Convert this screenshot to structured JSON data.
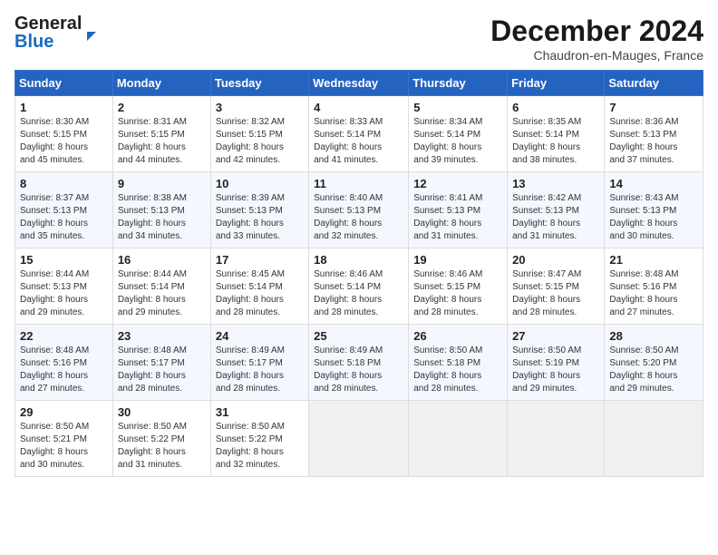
{
  "header": {
    "logo_general": "General",
    "logo_blue": "Blue",
    "title": "December 2024",
    "subtitle": "Chaudron-en-Mauges, France"
  },
  "calendar": {
    "days_of_week": [
      "Sunday",
      "Monday",
      "Tuesday",
      "Wednesday",
      "Thursday",
      "Friday",
      "Saturday"
    ],
    "weeks": [
      [
        {
          "day": "1",
          "info": "Sunrise: 8:30 AM\nSunset: 5:15 PM\nDaylight: 8 hours\nand 45 minutes."
        },
        {
          "day": "2",
          "info": "Sunrise: 8:31 AM\nSunset: 5:15 PM\nDaylight: 8 hours\nand 44 minutes."
        },
        {
          "day": "3",
          "info": "Sunrise: 8:32 AM\nSunset: 5:15 PM\nDaylight: 8 hours\nand 42 minutes."
        },
        {
          "day": "4",
          "info": "Sunrise: 8:33 AM\nSunset: 5:14 PM\nDaylight: 8 hours\nand 41 minutes."
        },
        {
          "day": "5",
          "info": "Sunrise: 8:34 AM\nSunset: 5:14 PM\nDaylight: 8 hours\nand 39 minutes."
        },
        {
          "day": "6",
          "info": "Sunrise: 8:35 AM\nSunset: 5:14 PM\nDaylight: 8 hours\nand 38 minutes."
        },
        {
          "day": "7",
          "info": "Sunrise: 8:36 AM\nSunset: 5:13 PM\nDaylight: 8 hours\nand 37 minutes."
        }
      ],
      [
        {
          "day": "8",
          "info": "Sunrise: 8:37 AM\nSunset: 5:13 PM\nDaylight: 8 hours\nand 35 minutes."
        },
        {
          "day": "9",
          "info": "Sunrise: 8:38 AM\nSunset: 5:13 PM\nDaylight: 8 hours\nand 34 minutes."
        },
        {
          "day": "10",
          "info": "Sunrise: 8:39 AM\nSunset: 5:13 PM\nDaylight: 8 hours\nand 33 minutes."
        },
        {
          "day": "11",
          "info": "Sunrise: 8:40 AM\nSunset: 5:13 PM\nDaylight: 8 hours\nand 32 minutes."
        },
        {
          "day": "12",
          "info": "Sunrise: 8:41 AM\nSunset: 5:13 PM\nDaylight: 8 hours\nand 31 minutes."
        },
        {
          "day": "13",
          "info": "Sunrise: 8:42 AM\nSunset: 5:13 PM\nDaylight: 8 hours\nand 31 minutes."
        },
        {
          "day": "14",
          "info": "Sunrise: 8:43 AM\nSunset: 5:13 PM\nDaylight: 8 hours\nand 30 minutes."
        }
      ],
      [
        {
          "day": "15",
          "info": "Sunrise: 8:44 AM\nSunset: 5:13 PM\nDaylight: 8 hours\nand 29 minutes."
        },
        {
          "day": "16",
          "info": "Sunrise: 8:44 AM\nSunset: 5:14 PM\nDaylight: 8 hours\nand 29 minutes."
        },
        {
          "day": "17",
          "info": "Sunrise: 8:45 AM\nSunset: 5:14 PM\nDaylight: 8 hours\nand 28 minutes."
        },
        {
          "day": "18",
          "info": "Sunrise: 8:46 AM\nSunset: 5:14 PM\nDaylight: 8 hours\nand 28 minutes."
        },
        {
          "day": "19",
          "info": "Sunrise: 8:46 AM\nSunset: 5:15 PM\nDaylight: 8 hours\nand 28 minutes."
        },
        {
          "day": "20",
          "info": "Sunrise: 8:47 AM\nSunset: 5:15 PM\nDaylight: 8 hours\nand 28 minutes."
        },
        {
          "day": "21",
          "info": "Sunrise: 8:48 AM\nSunset: 5:16 PM\nDaylight: 8 hours\nand 27 minutes."
        }
      ],
      [
        {
          "day": "22",
          "info": "Sunrise: 8:48 AM\nSunset: 5:16 PM\nDaylight: 8 hours\nand 27 minutes."
        },
        {
          "day": "23",
          "info": "Sunrise: 8:48 AM\nSunset: 5:17 PM\nDaylight: 8 hours\nand 28 minutes."
        },
        {
          "day": "24",
          "info": "Sunrise: 8:49 AM\nSunset: 5:17 PM\nDaylight: 8 hours\nand 28 minutes."
        },
        {
          "day": "25",
          "info": "Sunrise: 8:49 AM\nSunset: 5:18 PM\nDaylight: 8 hours\nand 28 minutes."
        },
        {
          "day": "26",
          "info": "Sunrise: 8:50 AM\nSunset: 5:18 PM\nDaylight: 8 hours\nand 28 minutes."
        },
        {
          "day": "27",
          "info": "Sunrise: 8:50 AM\nSunset: 5:19 PM\nDaylight: 8 hours\nand 29 minutes."
        },
        {
          "day": "28",
          "info": "Sunrise: 8:50 AM\nSunset: 5:20 PM\nDaylight: 8 hours\nand 29 minutes."
        }
      ],
      [
        {
          "day": "29",
          "info": "Sunrise: 8:50 AM\nSunset: 5:21 PM\nDaylight: 8 hours\nand 30 minutes."
        },
        {
          "day": "30",
          "info": "Sunrise: 8:50 AM\nSunset: 5:22 PM\nDaylight: 8 hours\nand 31 minutes."
        },
        {
          "day": "31",
          "info": "Sunrise: 8:50 AM\nSunset: 5:22 PM\nDaylight: 8 hours\nand 32 minutes."
        },
        {
          "day": "",
          "info": ""
        },
        {
          "day": "",
          "info": ""
        },
        {
          "day": "",
          "info": ""
        },
        {
          "day": "",
          "info": ""
        }
      ]
    ]
  }
}
